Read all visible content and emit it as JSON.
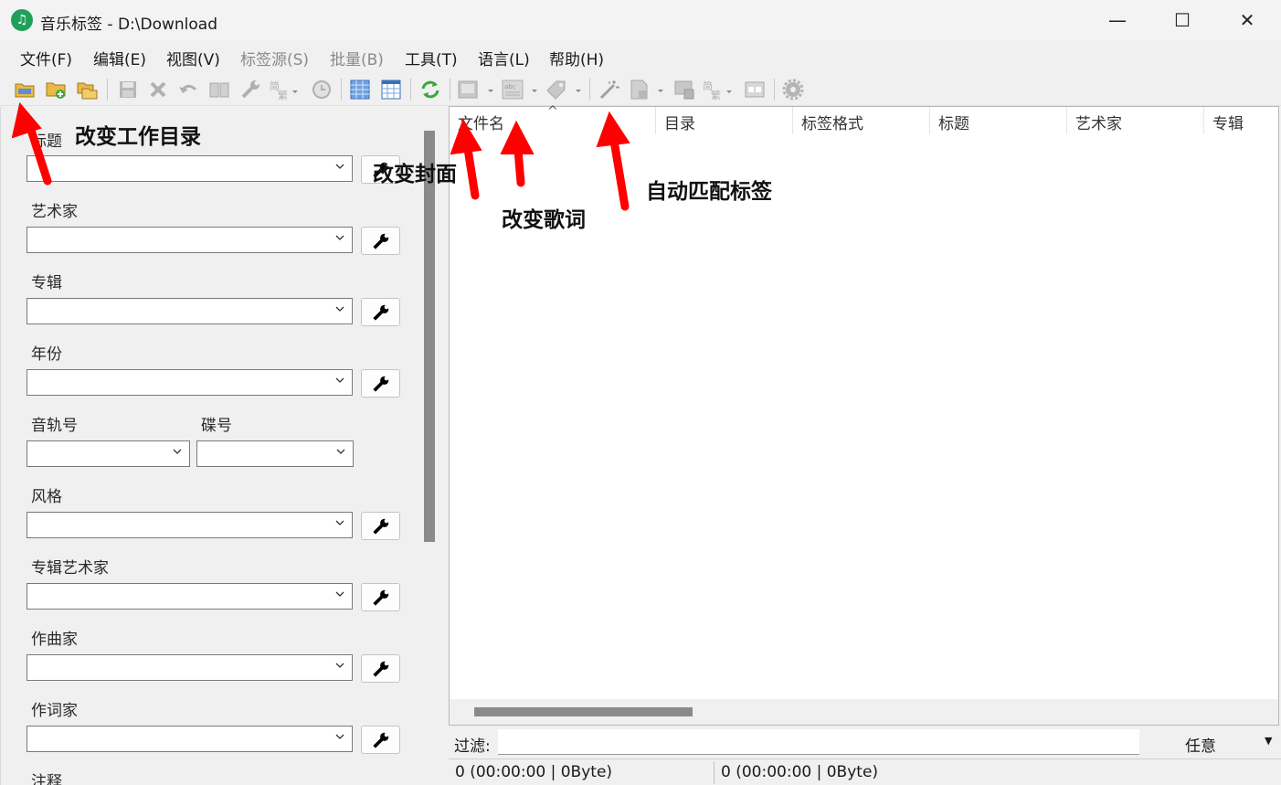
{
  "window": {
    "title": "音乐标签 - D:\\Download",
    "app_icon_glyph": "♫",
    "minimize_glyph": "—",
    "maximize_glyph": "☐",
    "close_glyph": "✕"
  },
  "menu": [
    {
      "label": "文件(F)",
      "enabled": true
    },
    {
      "label": "编辑(E)",
      "enabled": true
    },
    {
      "label": "视图(V)",
      "enabled": true
    },
    {
      "label": "标签源(S)",
      "enabled": false
    },
    {
      "label": "批量(B)",
      "enabled": false
    },
    {
      "label": "工具(T)",
      "enabled": true
    },
    {
      "label": "语言(L)",
      "enabled": true
    },
    {
      "label": "帮助(H)",
      "enabled": true
    }
  ],
  "toolbar_icons": [
    "open-folder-icon",
    "add-folder-icon",
    "change-folder-icon",
    "save-icon",
    "delete-icon",
    "undo-icon",
    "book-icon",
    "wrench-icon",
    "traditional-chinese-icon",
    "clock-icon",
    "grid-view-icon",
    "table-view-icon",
    "refresh-icon",
    "cover-image-icon",
    "lyrics-icon",
    "tag-icon",
    "magic-wand-icon",
    "export-icon",
    "screen-icon",
    "convert-icon",
    "window-icon",
    "settings-icon"
  ],
  "fields": [
    {
      "label": "标题"
    },
    {
      "label": "艺术家"
    },
    {
      "label": "专辑"
    },
    {
      "label": "年份"
    },
    {
      "label": "音轨号"
    },
    {
      "label": "碟号"
    },
    {
      "label": "风格"
    },
    {
      "label": "专辑艺术家"
    },
    {
      "label": "作曲家"
    },
    {
      "label": "作词家"
    },
    {
      "label": "注释"
    }
  ],
  "columns": [
    "文件名",
    "目录",
    "标签格式",
    "标题",
    "艺术家",
    "专辑"
  ],
  "sort_indicator": "^",
  "filter": {
    "label": "过滤:",
    "value": "",
    "mode": "任意"
  },
  "status": {
    "left": "0 (00:00:00 | 0Byte)",
    "right": "0 (00:00:00 | 0Byte)"
  },
  "annotations": [
    {
      "text": "改变工作目录"
    },
    {
      "text": "改变封面"
    },
    {
      "text": "改变歌词"
    },
    {
      "text": "自动匹配标签"
    }
  ],
  "colors": {
    "arrow": "#ff0000",
    "app_icon": "#1fa05a",
    "scroll_thumb": "#8a8a8a"
  }
}
